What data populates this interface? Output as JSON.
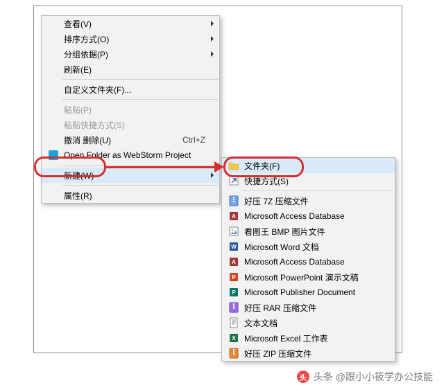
{
  "main_menu": {
    "items": [
      {
        "label": "查看(V)",
        "has_submenu": true
      },
      {
        "label": "排序方式(O)",
        "has_submenu": true
      },
      {
        "label": "分组依据(P)",
        "has_submenu": true
      },
      {
        "label": "刷新(E)"
      },
      {
        "sep": true
      },
      {
        "label": "自定义文件夹(F)..."
      },
      {
        "sep": true
      },
      {
        "label": "粘贴(P)",
        "disabled": true
      },
      {
        "label": "粘贴快捷方式(S)",
        "disabled": true
      },
      {
        "label": "撤消 删除(U)",
        "shortcut": "Ctrl+Z"
      },
      {
        "label": "Open Folder as WebStorm Project",
        "icon": "webstorm"
      },
      {
        "sep": true
      },
      {
        "label": "新建(W)",
        "has_submenu": true,
        "highlighted": true
      },
      {
        "sep": true
      },
      {
        "label": "属性(R)"
      }
    ]
  },
  "sub_menu": {
    "items": [
      {
        "label": "文件夹(F)",
        "icon": "folder",
        "highlighted": true
      },
      {
        "label": "快捷方式(S)",
        "icon": "shortcut"
      },
      {
        "sep": true
      },
      {
        "label": "好压 7Z 压缩文件",
        "icon": "archive-7z"
      },
      {
        "label": "Microsoft Access Database",
        "icon": "access"
      },
      {
        "label": "看图王 BMP 图片文件",
        "icon": "bmp"
      },
      {
        "label": "Microsoft Word 文档",
        "icon": "word"
      },
      {
        "label": "Microsoft Access Database",
        "icon": "access"
      },
      {
        "label": "Microsoft PowerPoint 演示文稿",
        "icon": "powerpoint"
      },
      {
        "label": "Microsoft Publisher Document",
        "icon": "publisher"
      },
      {
        "label": "好压 RAR 压缩文件",
        "icon": "archive-rar"
      },
      {
        "label": "文本文档",
        "icon": "text"
      },
      {
        "label": "Microsoft Excel 工作表",
        "icon": "excel"
      },
      {
        "label": "好压 ZIP 压缩文件",
        "icon": "archive-zip"
      }
    ]
  },
  "footer": {
    "prefix": "头条",
    "at": "@",
    "name": "跟小小筱学办公技能"
  }
}
